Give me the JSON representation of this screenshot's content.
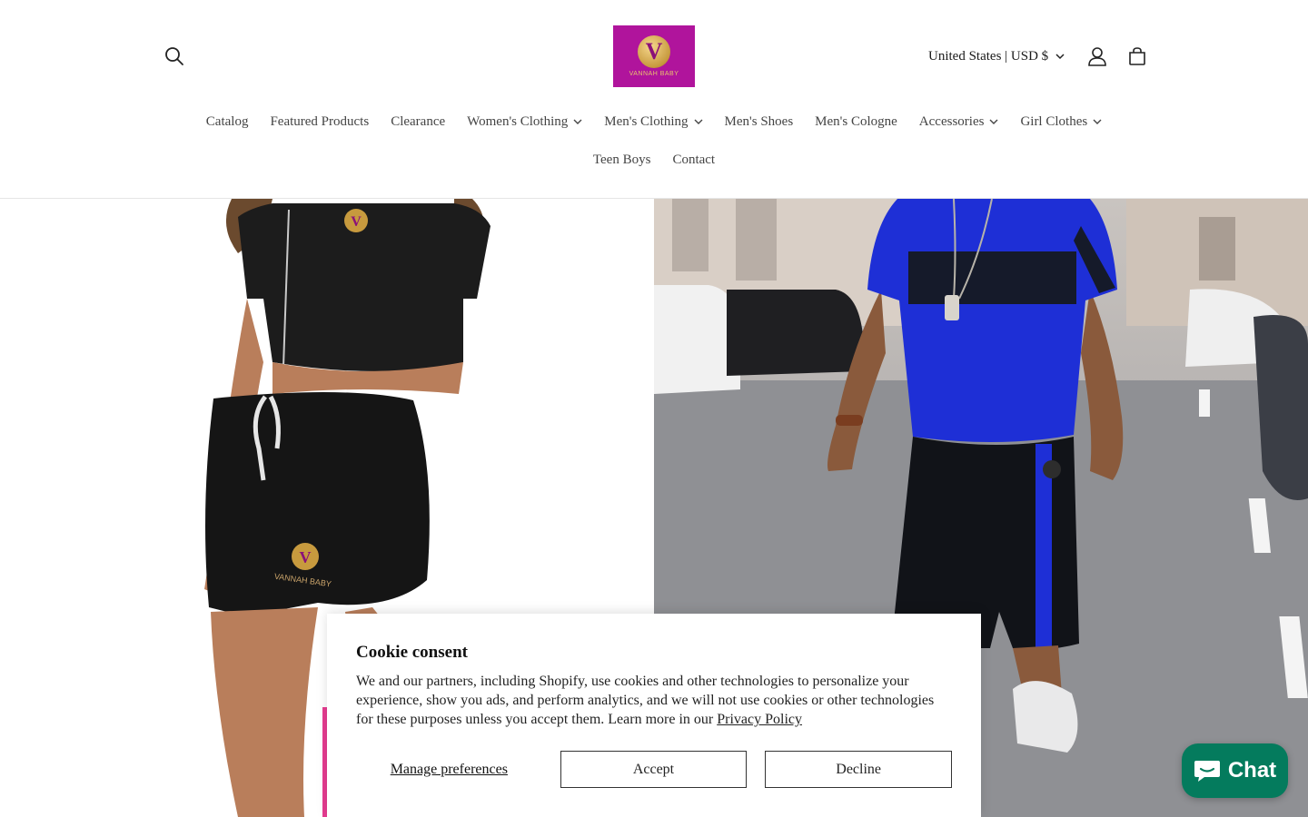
{
  "header": {
    "logo_text": "VANNAH BABY",
    "logo_letter": "V",
    "country_selector": "United States | USD $",
    "icons": {
      "search": "search-icon",
      "account": "account-icon",
      "cart": "cart-icon",
      "chevron": "chevron-down-icon"
    }
  },
  "nav": {
    "row1": [
      {
        "label": "Catalog",
        "dropdown": false
      },
      {
        "label": "Featured Products",
        "dropdown": false
      },
      {
        "label": "Clearance",
        "dropdown": false
      },
      {
        "label": "Women's Clothing",
        "dropdown": true
      },
      {
        "label": "Men's Clothing",
        "dropdown": true
      },
      {
        "label": "Men's Shoes",
        "dropdown": false
      },
      {
        "label": "Men's Cologne",
        "dropdown": false
      },
      {
        "label": "Accessories",
        "dropdown": true
      },
      {
        "label": "Girl Clothes",
        "dropdown": true
      }
    ],
    "row2": [
      {
        "label": "Teen Boys",
        "dropdown": false
      },
      {
        "label": "Contact",
        "dropdown": false
      }
    ]
  },
  "hero": {
    "left_image_logo_text": "VANNAH BABY"
  },
  "cookie": {
    "title": "Cookie consent",
    "body": "We and our partners, including Shopify, use cookies and other technologies to personalize your experience, show you ads, and perform analytics, and we will not use cookies or other technologies for these purposes unless you accept them. Learn more in our ",
    "link": "Privacy Policy",
    "manage": "Manage preferences",
    "accept": "Accept",
    "decline": "Decline"
  },
  "chat": {
    "label": "Chat",
    "icon": "chat-bubble-icon"
  },
  "colors": {
    "logo_bg": "#b0149c",
    "chat_bg": "#047b5d",
    "blue_shirt": "#1e2fd6"
  }
}
